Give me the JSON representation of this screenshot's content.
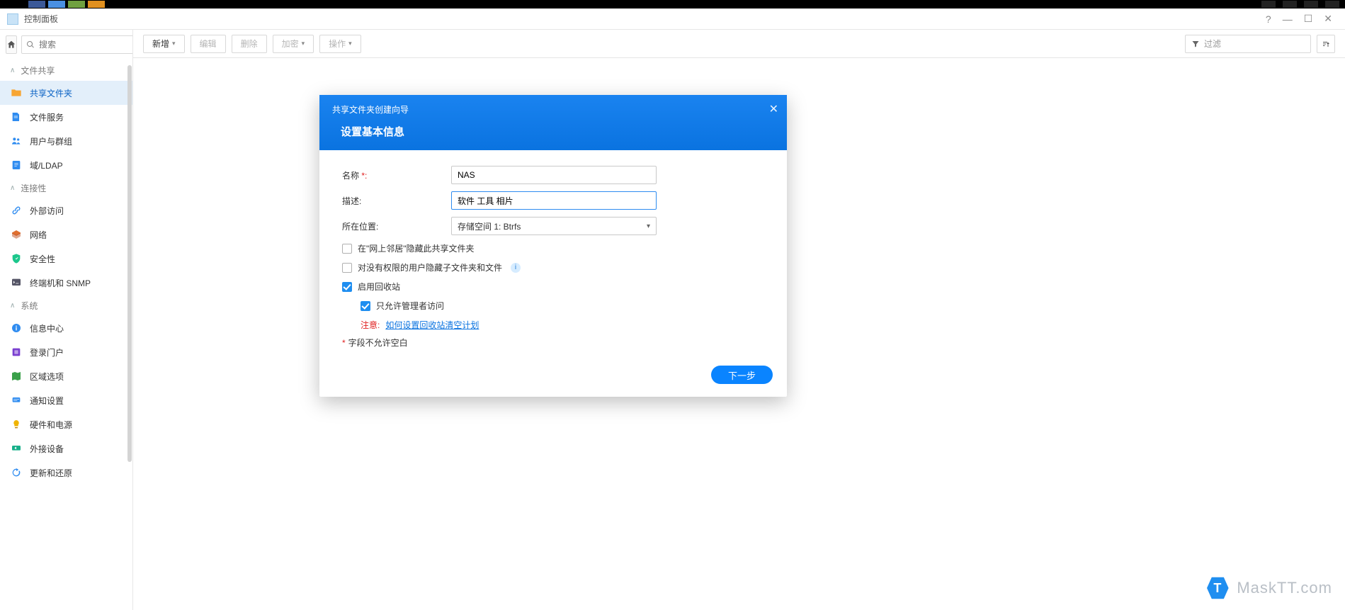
{
  "window": {
    "title": "控制面板"
  },
  "header": {
    "help": "?",
    "min": "—",
    "max": "☐",
    "close": "✕"
  },
  "search": {
    "placeholder": "搜索"
  },
  "sidebar": {
    "groups": [
      {
        "title": "文件共享",
        "items": [
          {
            "key": "shared-folder",
            "label": "共享文件夹",
            "active": true,
            "icon": "folder",
            "color": "#f7a533"
          },
          {
            "key": "file-services",
            "label": "文件服务",
            "icon": "file",
            "color": "#2f8cf0"
          },
          {
            "key": "user-group",
            "label": "用户与群组",
            "icon": "users",
            "color": "#2f8cf0"
          },
          {
            "key": "domain-ldap",
            "label": "域/LDAP",
            "icon": "ldap",
            "color": "#2f8cf0"
          }
        ]
      },
      {
        "title": "连接性",
        "items": [
          {
            "key": "external-access",
            "label": "外部访问",
            "icon": "link",
            "color": "#2f8cf0"
          },
          {
            "key": "network",
            "label": "网络",
            "icon": "net",
            "color": "#e07030"
          },
          {
            "key": "security",
            "label": "安全性",
            "icon": "shield",
            "color": "#1cc78c"
          },
          {
            "key": "terminal-snmp",
            "label": "终端机和 SNMP",
            "icon": "terminal",
            "color": "#556"
          }
        ]
      },
      {
        "title": "系统",
        "items": [
          {
            "key": "info-center",
            "label": "信息中心",
            "icon": "info",
            "color": "#2f8cf0"
          },
          {
            "key": "login-portal",
            "label": "登录门户",
            "icon": "portal",
            "color": "#7a3fd0"
          },
          {
            "key": "regional",
            "label": "区域选项",
            "icon": "region",
            "color": "#3aa04a"
          },
          {
            "key": "notification",
            "label": "通知设置",
            "icon": "notify",
            "color": "#2f8cf0"
          },
          {
            "key": "hardware-power",
            "label": "硬件和电源",
            "icon": "bulb",
            "color": "#f0b400"
          },
          {
            "key": "external-devices",
            "label": "外接设备",
            "icon": "ext",
            "color": "#18b08a"
          },
          {
            "key": "update-restore",
            "label": "更新和还原",
            "icon": "update",
            "color": "#2f8cf0"
          }
        ]
      }
    ]
  },
  "toolbar": {
    "create": "新增",
    "edit": "编辑",
    "delete": "删除",
    "encrypt": "加密",
    "action": "操作",
    "filter": "过滤"
  },
  "modal": {
    "title": "共享文件夹创建向导",
    "subtitle": "设置基本信息",
    "labels": {
      "name": "名称",
      "desc": "描述:",
      "location": "所在位置:"
    },
    "name_req": "*:",
    "values": {
      "name": "NAS",
      "desc": "软件 工具 相片",
      "location": "存储空间 1:  Btrfs"
    },
    "checks": {
      "hide_network": "在\"网上邻居\"隐藏此共享文件夹",
      "hide_noaccess": "对没有权限的用户隐藏子文件夹和文件",
      "enable_recycle": "启用回收站",
      "admin_only": "只允许管理者访问"
    },
    "note": {
      "label": "注意:",
      "link": "如何设置回收站清空计划"
    },
    "required_note": "字段不允许空白",
    "next": "下一步"
  },
  "watermark": {
    "letter": "T",
    "text": "MaskTT.com"
  }
}
